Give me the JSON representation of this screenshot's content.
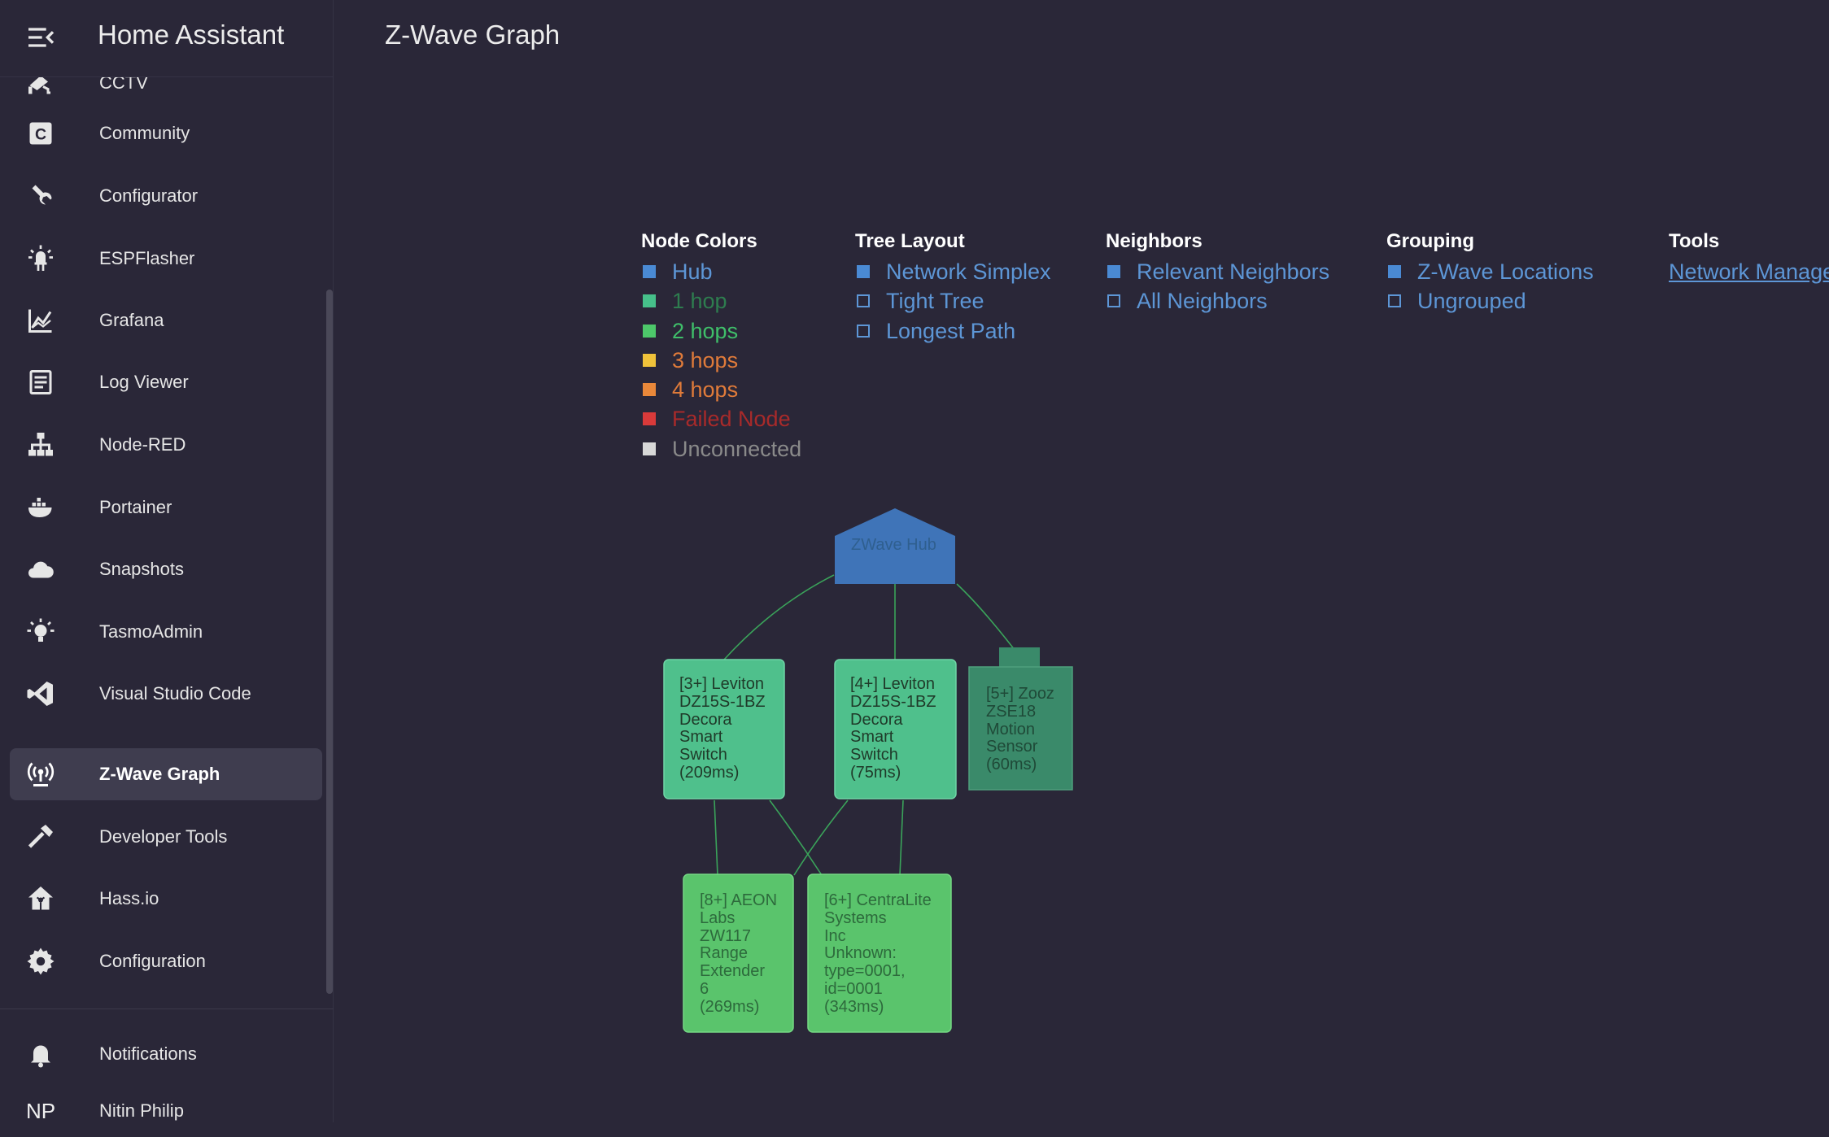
{
  "app": {
    "title": "Home Assistant"
  },
  "sidebar": {
    "items": [
      {
        "label": "CCTV",
        "icon": "cctv-icon"
      },
      {
        "label": "Community",
        "icon": "community-icon"
      },
      {
        "label": "Configurator",
        "icon": "wrench-icon"
      },
      {
        "label": "ESPFlasher",
        "icon": "led-icon"
      },
      {
        "label": "Grafana",
        "icon": "chart-icon"
      },
      {
        "label": "Log Viewer",
        "icon": "log-icon"
      },
      {
        "label": "Node-RED",
        "icon": "sitemap-icon"
      },
      {
        "label": "Portainer",
        "icon": "docker-icon"
      },
      {
        "label": "Snapshots",
        "icon": "cloud-icon"
      },
      {
        "label": "TasmoAdmin",
        "icon": "lightbulb-icon"
      },
      {
        "label": "Visual Studio Code",
        "icon": "vscode-icon"
      },
      {
        "label": "Z-Wave Graph",
        "icon": "zwave-icon",
        "active": true
      },
      {
        "label": "Developer Tools",
        "icon": "hammer-icon"
      },
      {
        "label": "Hass.io",
        "icon": "home-assistant-icon"
      },
      {
        "label": "Configuration",
        "icon": "gear-icon"
      }
    ],
    "notifications_label": "Notifications",
    "user": {
      "initials": "NP",
      "name": "Nitin Philip"
    }
  },
  "page": {
    "title": "Z-Wave Graph"
  },
  "legend": {
    "node_colors": {
      "heading": "Node Colors",
      "items": [
        {
          "label": "Hub",
          "swatch": "#4a8ad4",
          "text_color": "#5d96d6"
        },
        {
          "label": "1 hop",
          "swatch": "#46c08a",
          "text_color": "#2e7d4f"
        },
        {
          "label": "2 hops",
          "swatch": "#4dc86a",
          "text_color": "#3fbf6a"
        },
        {
          "label": "3 hops",
          "swatch": "#f0c23a",
          "text_color": "#e07b3a"
        },
        {
          "label": "4 hops",
          "swatch": "#e9883a",
          "text_color": "#e07b3a"
        },
        {
          "label": "Failed Node",
          "swatch": "#d93a3a",
          "text_color": "#a82a2a"
        },
        {
          "label": "Unconnected",
          "swatch": "#d8d8d8",
          "text_color": "#8a8a8a"
        }
      ]
    },
    "tree_layout": {
      "heading": "Tree Layout",
      "options": [
        {
          "label": "Network Simplex",
          "selected": true
        },
        {
          "label": "Tight Tree",
          "selected": false
        },
        {
          "label": "Longest Path",
          "selected": false
        }
      ]
    },
    "neighbors": {
      "heading": "Neighbors",
      "options": [
        {
          "label": "Relevant Neighbors",
          "selected": true
        },
        {
          "label": "All Neighbors",
          "selected": false
        }
      ]
    },
    "grouping": {
      "heading": "Grouping",
      "options": [
        {
          "label": "Z-Wave Locations",
          "selected": true
        },
        {
          "label": "Ungrouped",
          "selected": false
        }
      ]
    },
    "tools": {
      "heading": "Tools",
      "link": "Network Manage"
    }
  },
  "graph": {
    "hub": {
      "label": "ZWave Hub"
    },
    "nodes": [
      {
        "id": "n3",
        "label": "[3+] Leviton\nDZ15S-1BZ\nDecora\nSmart\nSwitch\n(209ms)"
      },
      {
        "id": "n4",
        "label": "[4+] Leviton\nDZ15S-1BZ\nDecora\nSmart\nSwitch\n(75ms)"
      },
      {
        "id": "n5",
        "label": "[5+] Zooz\nZSE18\nMotion\nSensor\n(60ms)"
      },
      {
        "id": "n8",
        "label": "[8+] AEON\nLabs\nZW117\nRange\nExtender\n6\n(269ms)"
      },
      {
        "id": "n6",
        "label": "[6+] CentraLite\nSystems\nInc\nUnknown:\ntype=0001,\nid=0001\n(343ms)"
      }
    ]
  }
}
